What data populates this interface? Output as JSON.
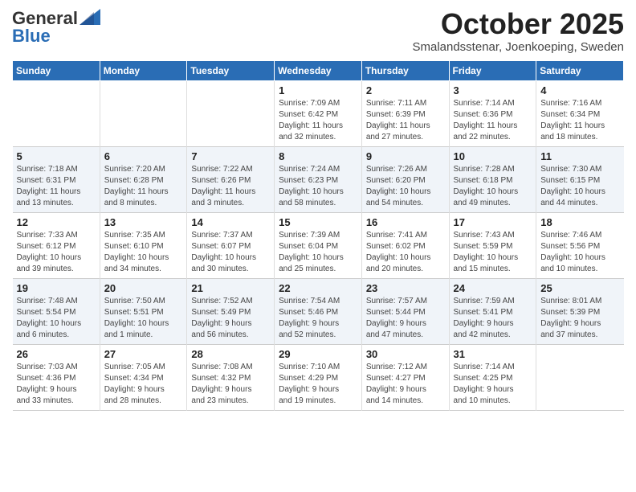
{
  "header": {
    "logo_line1": "General",
    "logo_line2": "Blue",
    "month": "October 2025",
    "location": "Smalandsstenar, Joenkoeping, Sweden"
  },
  "days_of_week": [
    "Sunday",
    "Monday",
    "Tuesday",
    "Wednesday",
    "Thursday",
    "Friday",
    "Saturday"
  ],
  "weeks": [
    [
      {
        "day": "",
        "info": ""
      },
      {
        "day": "",
        "info": ""
      },
      {
        "day": "",
        "info": ""
      },
      {
        "day": "1",
        "info": "Sunrise: 7:09 AM\nSunset: 6:42 PM\nDaylight: 11 hours\nand 32 minutes."
      },
      {
        "day": "2",
        "info": "Sunrise: 7:11 AM\nSunset: 6:39 PM\nDaylight: 11 hours\nand 27 minutes."
      },
      {
        "day": "3",
        "info": "Sunrise: 7:14 AM\nSunset: 6:36 PM\nDaylight: 11 hours\nand 22 minutes."
      },
      {
        "day": "4",
        "info": "Sunrise: 7:16 AM\nSunset: 6:34 PM\nDaylight: 11 hours\nand 18 minutes."
      }
    ],
    [
      {
        "day": "5",
        "info": "Sunrise: 7:18 AM\nSunset: 6:31 PM\nDaylight: 11 hours\nand 13 minutes."
      },
      {
        "day": "6",
        "info": "Sunrise: 7:20 AM\nSunset: 6:28 PM\nDaylight: 11 hours\nand 8 minutes."
      },
      {
        "day": "7",
        "info": "Sunrise: 7:22 AM\nSunset: 6:26 PM\nDaylight: 11 hours\nand 3 minutes."
      },
      {
        "day": "8",
        "info": "Sunrise: 7:24 AM\nSunset: 6:23 PM\nDaylight: 10 hours\nand 58 minutes."
      },
      {
        "day": "9",
        "info": "Sunrise: 7:26 AM\nSunset: 6:20 PM\nDaylight: 10 hours\nand 54 minutes."
      },
      {
        "day": "10",
        "info": "Sunrise: 7:28 AM\nSunset: 6:18 PM\nDaylight: 10 hours\nand 49 minutes."
      },
      {
        "day": "11",
        "info": "Sunrise: 7:30 AM\nSunset: 6:15 PM\nDaylight: 10 hours\nand 44 minutes."
      }
    ],
    [
      {
        "day": "12",
        "info": "Sunrise: 7:33 AM\nSunset: 6:12 PM\nDaylight: 10 hours\nand 39 minutes."
      },
      {
        "day": "13",
        "info": "Sunrise: 7:35 AM\nSunset: 6:10 PM\nDaylight: 10 hours\nand 34 minutes."
      },
      {
        "day": "14",
        "info": "Sunrise: 7:37 AM\nSunset: 6:07 PM\nDaylight: 10 hours\nand 30 minutes."
      },
      {
        "day": "15",
        "info": "Sunrise: 7:39 AM\nSunset: 6:04 PM\nDaylight: 10 hours\nand 25 minutes."
      },
      {
        "day": "16",
        "info": "Sunrise: 7:41 AM\nSunset: 6:02 PM\nDaylight: 10 hours\nand 20 minutes."
      },
      {
        "day": "17",
        "info": "Sunrise: 7:43 AM\nSunset: 5:59 PM\nDaylight: 10 hours\nand 15 minutes."
      },
      {
        "day": "18",
        "info": "Sunrise: 7:46 AM\nSunset: 5:56 PM\nDaylight: 10 hours\nand 10 minutes."
      }
    ],
    [
      {
        "day": "19",
        "info": "Sunrise: 7:48 AM\nSunset: 5:54 PM\nDaylight: 10 hours\nand 6 minutes."
      },
      {
        "day": "20",
        "info": "Sunrise: 7:50 AM\nSunset: 5:51 PM\nDaylight: 10 hours\nand 1 minute."
      },
      {
        "day": "21",
        "info": "Sunrise: 7:52 AM\nSunset: 5:49 PM\nDaylight: 9 hours\nand 56 minutes."
      },
      {
        "day": "22",
        "info": "Sunrise: 7:54 AM\nSunset: 5:46 PM\nDaylight: 9 hours\nand 52 minutes."
      },
      {
        "day": "23",
        "info": "Sunrise: 7:57 AM\nSunset: 5:44 PM\nDaylight: 9 hours\nand 47 minutes."
      },
      {
        "day": "24",
        "info": "Sunrise: 7:59 AM\nSunset: 5:41 PM\nDaylight: 9 hours\nand 42 minutes."
      },
      {
        "day": "25",
        "info": "Sunrise: 8:01 AM\nSunset: 5:39 PM\nDaylight: 9 hours\nand 37 minutes."
      }
    ],
    [
      {
        "day": "26",
        "info": "Sunrise: 7:03 AM\nSunset: 4:36 PM\nDaylight: 9 hours\nand 33 minutes."
      },
      {
        "day": "27",
        "info": "Sunrise: 7:05 AM\nSunset: 4:34 PM\nDaylight: 9 hours\nand 28 minutes."
      },
      {
        "day": "28",
        "info": "Sunrise: 7:08 AM\nSunset: 4:32 PM\nDaylight: 9 hours\nand 23 minutes."
      },
      {
        "day": "29",
        "info": "Sunrise: 7:10 AM\nSunset: 4:29 PM\nDaylight: 9 hours\nand 19 minutes."
      },
      {
        "day": "30",
        "info": "Sunrise: 7:12 AM\nSunset: 4:27 PM\nDaylight: 9 hours\nand 14 minutes."
      },
      {
        "day": "31",
        "info": "Sunrise: 7:14 AM\nSunset: 4:25 PM\nDaylight: 9 hours\nand 10 minutes."
      },
      {
        "day": "",
        "info": ""
      }
    ]
  ]
}
